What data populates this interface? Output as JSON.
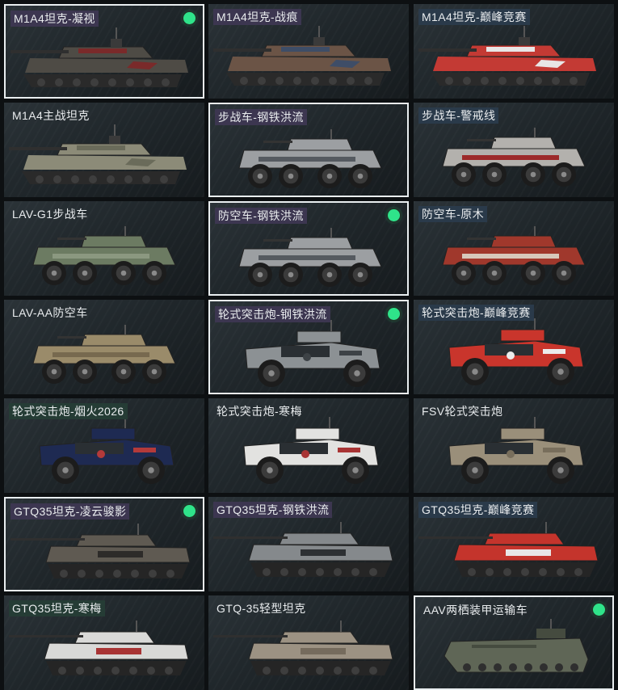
{
  "vehicles": [
    {
      "name": "M1A4坦克-凝视",
      "equipped": true,
      "selected": true,
      "kind": "tank",
      "hull": "#4e4b45",
      "accent": "#7a2a2a",
      "tag": "purple"
    },
    {
      "name": "M1A4坦克-战痕",
      "equipped": false,
      "selected": false,
      "kind": "tank",
      "hull": "#6b5446",
      "accent": "#3e4d67",
      "tag": "purple"
    },
    {
      "name": "M1A4坦克-巅峰竞赛",
      "equipped": false,
      "selected": false,
      "kind": "tank",
      "hull": "#c33a34",
      "accent": "#e8e6e6",
      "tag": "slate"
    },
    {
      "name": "M1A4主战坦克",
      "equipped": false,
      "selected": false,
      "kind": "tank",
      "hull": "#8c8b78",
      "accent": "#6a6b5a",
      "tag": "plain"
    },
    {
      "name": "步战车-钢铁洪流",
      "equipped": false,
      "selected": true,
      "kind": "ifv",
      "hull": "#9c9fa2",
      "accent": "#555a60",
      "tag": "purple"
    },
    {
      "name": "步战车-警戒线",
      "equipped": false,
      "selected": false,
      "kind": "ifv",
      "hull": "#b3b1ad",
      "accent": "#9c2a2a",
      "tag": "slate"
    },
    {
      "name": "LAV-G1步战车",
      "equipped": false,
      "selected": false,
      "kind": "ifv",
      "hull": "#6c7b62",
      "accent": "#8b9880",
      "tag": "plain"
    },
    {
      "name": "防空车-钢铁洪流",
      "equipped": true,
      "selected": true,
      "kind": "ifv",
      "hull": "#9c9fa2",
      "accent": "#555a60",
      "tag": "purple"
    },
    {
      "name": "防空车-原木",
      "equipped": false,
      "selected": false,
      "kind": "ifv",
      "hull": "#a0382c",
      "accent": "#d7c8bb",
      "tag": "slate"
    },
    {
      "name": "LAV-AA防空车",
      "equipped": false,
      "selected": false,
      "kind": "ifv",
      "hull": "#9a8b6a",
      "accent": "#77694f",
      "tag": "plain"
    },
    {
      "name": "轮式突击炮-钢铁洪流",
      "equipped": true,
      "selected": true,
      "kind": "truck",
      "hull": "#8c9194",
      "accent": "#3d4246",
      "tag": "purple"
    },
    {
      "name": "轮式突击炮-巅峰竞赛",
      "equipped": false,
      "selected": false,
      "kind": "truck",
      "hull": "#c9352c",
      "accent": "#ececec",
      "tag": "slate"
    },
    {
      "name": "轮式突击炮-烟火2026",
      "equipped": false,
      "selected": false,
      "kind": "truck",
      "hull": "#1e2a52",
      "accent": "#b33a3a",
      "tag": "green"
    },
    {
      "name": "轮式突击炮-寒梅",
      "equipped": false,
      "selected": false,
      "kind": "truck",
      "hull": "#e2e2e0",
      "accent": "#a83434",
      "tag": "plain"
    },
    {
      "name": "FSV轮式突击炮",
      "equipped": false,
      "selected": false,
      "kind": "truck",
      "hull": "#9a8f7a",
      "accent": "#786e5c",
      "tag": "plain"
    },
    {
      "name": "GTQ35坦克-凌云骏影",
      "equipped": true,
      "selected": true,
      "kind": "light",
      "hull": "#5f5a52",
      "accent": "#2d2b29",
      "tag": "purple"
    },
    {
      "name": "GTQ35坦克-钢铁洪流",
      "equipped": false,
      "selected": false,
      "kind": "light",
      "hull": "#85898c",
      "accent": "#2d3033",
      "tag": "purple"
    },
    {
      "name": "GTQ35坦克-巅峰竞赛",
      "equipped": false,
      "selected": false,
      "kind": "light",
      "hull": "#c4342c",
      "accent": "#e8e6e6",
      "tag": "slate"
    },
    {
      "name": "GTQ35坦克-寒梅",
      "equipped": false,
      "selected": false,
      "kind": "light",
      "hull": "#d9d9d7",
      "accent": "#a83434",
      "tag": "green"
    },
    {
      "name": "GTQ-35轻型坦克",
      "equipped": false,
      "selected": false,
      "kind": "light",
      "hull": "#9c9283",
      "accent": "#756b5d",
      "tag": "plain"
    },
    {
      "name": "AAV两栖装甲运输车",
      "equipped": true,
      "selected": true,
      "kind": "amphib",
      "hull": "#5f6656",
      "accent": "#454b3f",
      "tag": "plain"
    }
  ]
}
